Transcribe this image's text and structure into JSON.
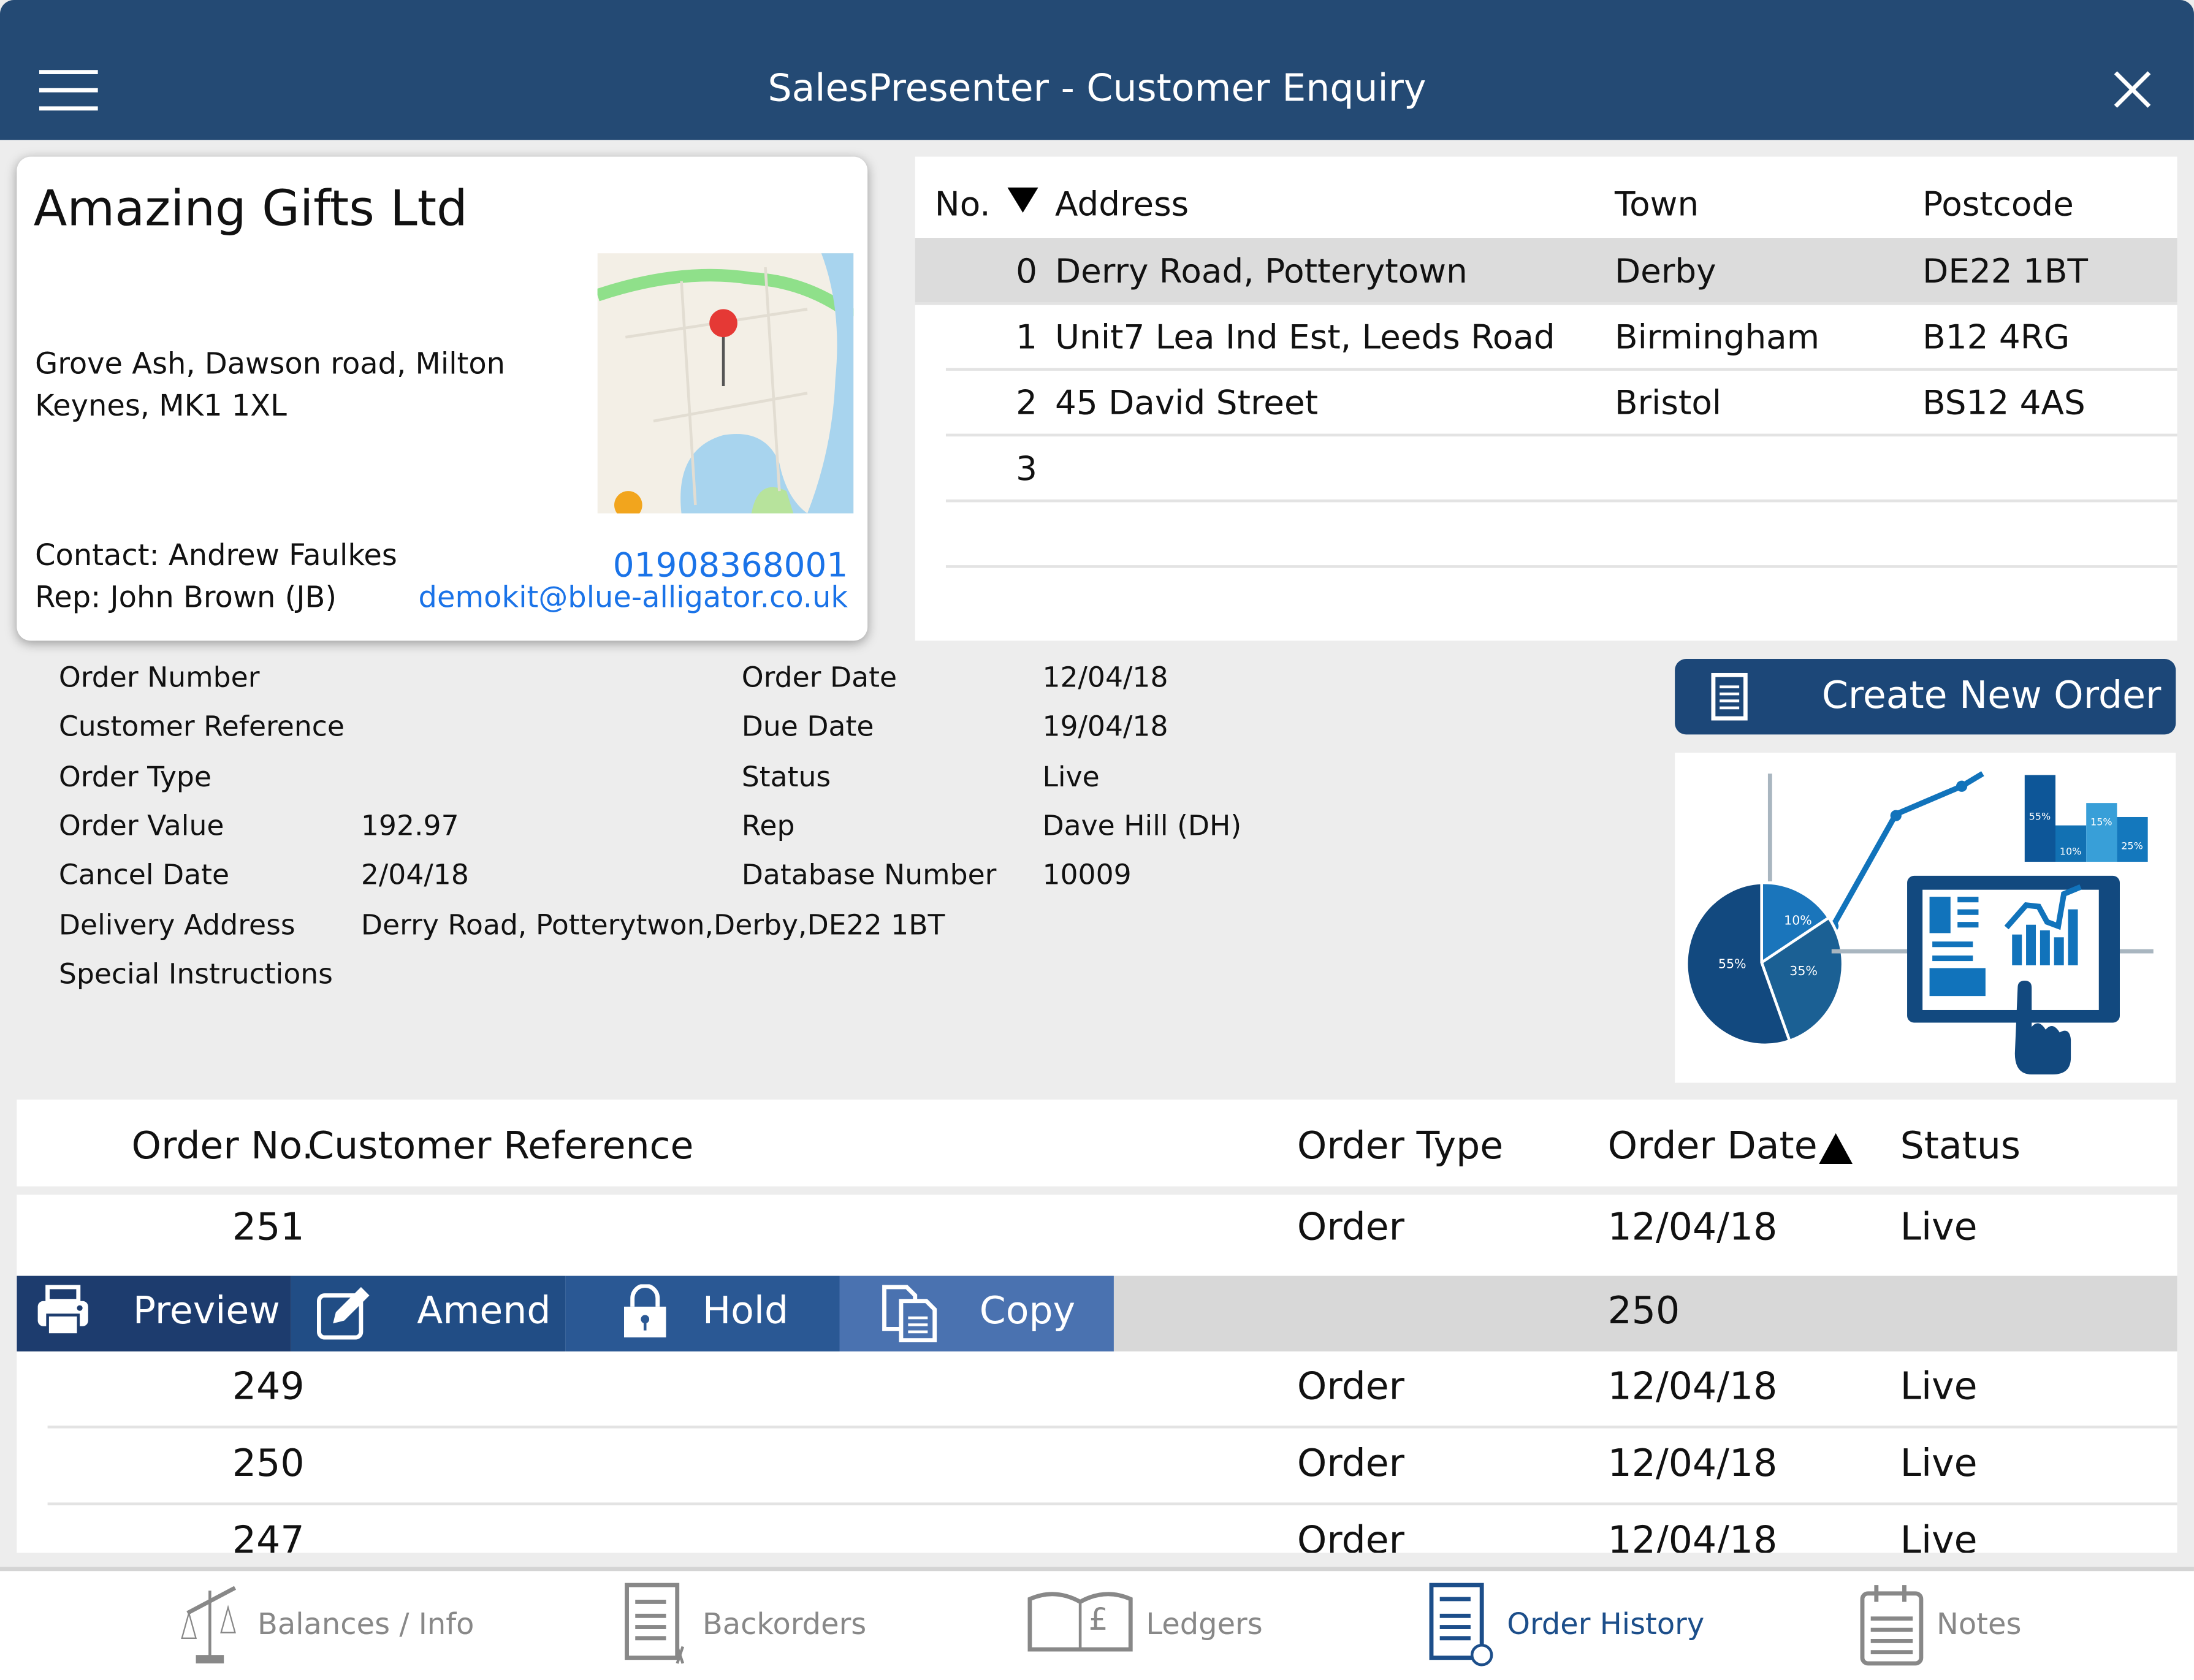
{
  "header": {
    "title": "SalesPresenter - Customer Enquiry",
    "menu_icon": "hamburger-icon",
    "close_icon": "close-icon",
    "color": "#244a74"
  },
  "customer": {
    "name": "Amazing Gifts Ltd",
    "address_line1": "Grove Ash, Dawson road, Milton",
    "address_line2": "Keynes, MK1 1XL",
    "contact": "Contact: Andrew Faulkes",
    "rep": "Rep: John Brown (JB)",
    "phone": "01908368001",
    "email": "demokit@blue-alligator.co.uk",
    "link_color": "#1a73e8"
  },
  "addresses": {
    "headers": {
      "no": "No.",
      "address": "Address",
      "town": "Town",
      "postcode": "Postcode"
    },
    "sort": "descending",
    "rows": [
      {
        "no": "0",
        "address": "Derry Road, Potterytown",
        "town": "Derby",
        "postcode": "DE22 1BT",
        "selected": true
      },
      {
        "no": "1",
        "address": "Unit7 Lea Ind Est, Leeds Road",
        "town": "Birmingham",
        "postcode": "B12 4RG"
      },
      {
        "no": "2",
        "address": "45 David Street",
        "town": "Bristol",
        "postcode": "BS12 4AS"
      },
      {
        "no": "3",
        "address": "",
        "town": "",
        "postcode": ""
      }
    ]
  },
  "order_details": {
    "left": [
      {
        "label": "Order Number",
        "value": ""
      },
      {
        "label": "Customer Reference",
        "value": ""
      },
      {
        "label": "Order Type",
        "value": ""
      },
      {
        "label": "Order Value",
        "value": "192.97"
      },
      {
        "label": "Cancel Date",
        "value": "2/04/18"
      },
      {
        "label": "Delivery Address",
        "value": "Derry Road, Potterytwon,Derby,DE22 1BT"
      },
      {
        "label": "Special Instructions",
        "value": ""
      }
    ],
    "right": [
      {
        "label": "Order Date",
        "value": "12/04/18"
      },
      {
        "label": "Due Date",
        "value": "19/04/18"
      },
      {
        "label": "Status",
        "value": "Live"
      },
      {
        "label": "Rep",
        "value": "Dave Hill (DH)"
      },
      {
        "label": "Database Number",
        "value": "10009"
      }
    ]
  },
  "create_order": {
    "label": "Create New Order",
    "icon": "document-icon"
  },
  "illustration": {
    "pie_labels": [
      "10%",
      "35%",
      "55%"
    ],
    "bar_labels": [
      "55%",
      "10%",
      "15%",
      "25%"
    ]
  },
  "orders": {
    "headers": {
      "order_no": "Order No.",
      "cust_ref": "Customer Reference",
      "type": "Order Type",
      "date": "Order Date",
      "status": "Status"
    },
    "sort": "ascending",
    "rows": [
      {
        "no": "251",
        "type": "Order",
        "date": "12/04/18",
        "status": "Live"
      },
      {
        "no": "250",
        "selected": true
      },
      {
        "no": "249",
        "type": "Order",
        "date": "12/04/18",
        "status": "Live"
      },
      {
        "no": "250",
        "type": "Order",
        "date": "12/04/18",
        "status": "Live"
      },
      {
        "no": "247",
        "type": "Order",
        "date": "12/04/18",
        "status": "Live"
      }
    ],
    "actions": [
      {
        "label": "Preview",
        "icon": "printer-icon",
        "color": "#1d3c6e"
      },
      {
        "label": "Amend",
        "icon": "edit-icon",
        "color": "#214d85"
      },
      {
        "label": "Hold",
        "icon": "lock-icon",
        "color": "#2a5894"
      },
      {
        "label": "Copy",
        "icon": "copy-icon",
        "color": "#4a72b0"
      }
    ]
  },
  "nav": {
    "active": "Order History",
    "active_color": "#1c4e8a",
    "items": [
      {
        "label": "Balances / Info",
        "icon": "scales-icon"
      },
      {
        "label": "Backorders",
        "icon": "backorders-icon"
      },
      {
        "label": "Ledgers",
        "icon": "ledger-book-icon"
      },
      {
        "label": "Order History",
        "icon": "order-history-icon"
      },
      {
        "label": "Notes",
        "icon": "notepad-icon"
      }
    ]
  }
}
